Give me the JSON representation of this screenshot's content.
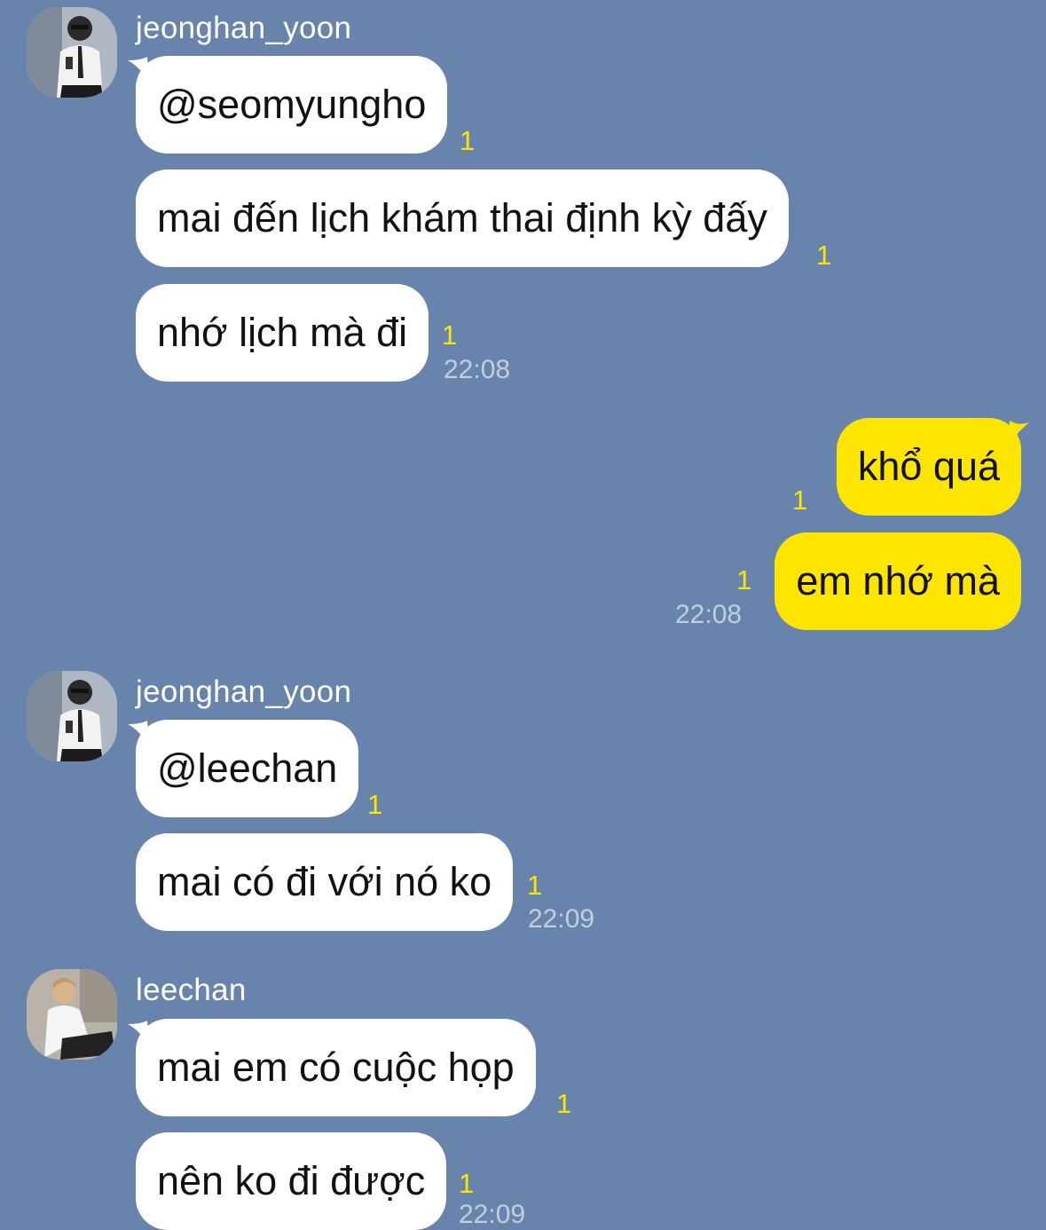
{
  "colors": {
    "background": "#6884ad",
    "incoming_bubble": "#ffffff",
    "outgoing_bubble": "#fee500",
    "unread_count": "#fee500",
    "timestamp": "#c3cedd"
  },
  "groups": [
    {
      "sender": "jeonghan_yoon",
      "avatar": "profile-photo-man-in-shirt-with-phone",
      "messages": [
        {
          "text": "@seomyungho",
          "unread": "1"
        },
        {
          "text": "mai đến lịch khám thai định kỳ đấy",
          "unread": "1"
        },
        {
          "text": "nhớ lịch mà đi",
          "unread": "1",
          "time": "22:08"
        }
      ]
    },
    {
      "sender": "me",
      "messages": [
        {
          "text": "khổ quá",
          "unread": "1"
        },
        {
          "text": "em nhớ mà",
          "unread": "1",
          "time": "22:08"
        }
      ]
    },
    {
      "sender": "jeonghan_yoon",
      "avatar": "profile-photo-man-in-shirt-with-phone",
      "messages": [
        {
          "text": "@leechan",
          "unread": "1"
        },
        {
          "text": "mai có đi với nó ko",
          "unread": "1",
          "time": "22:09"
        }
      ]
    },
    {
      "sender": "leechan",
      "avatar": "profile-photo-man-sitting",
      "messages": [
        {
          "text": "mai em có cuộc họp",
          "unread": "1"
        },
        {
          "text": "nên ko đi được",
          "unread": "1",
          "time": "22:09"
        }
      ]
    }
  ]
}
